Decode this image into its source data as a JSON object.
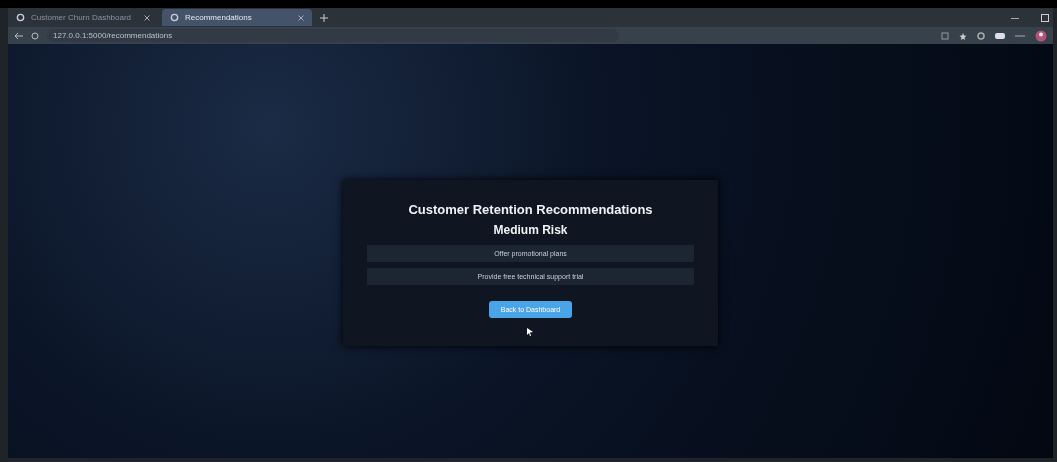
{
  "browser": {
    "tabs": [
      {
        "title": "Customer Churn Dashboard",
        "selected": false
      },
      {
        "title": "Recommendations",
        "selected": true
      }
    ],
    "address": "127.0.0.1:5000/recommendations"
  },
  "card": {
    "title": "Customer Retention Recommendations",
    "risk": "Medium Risk",
    "recommendations": [
      "Offer promotional plans",
      "Provide free technical support trial"
    ],
    "button": "Back to Dashboard"
  }
}
